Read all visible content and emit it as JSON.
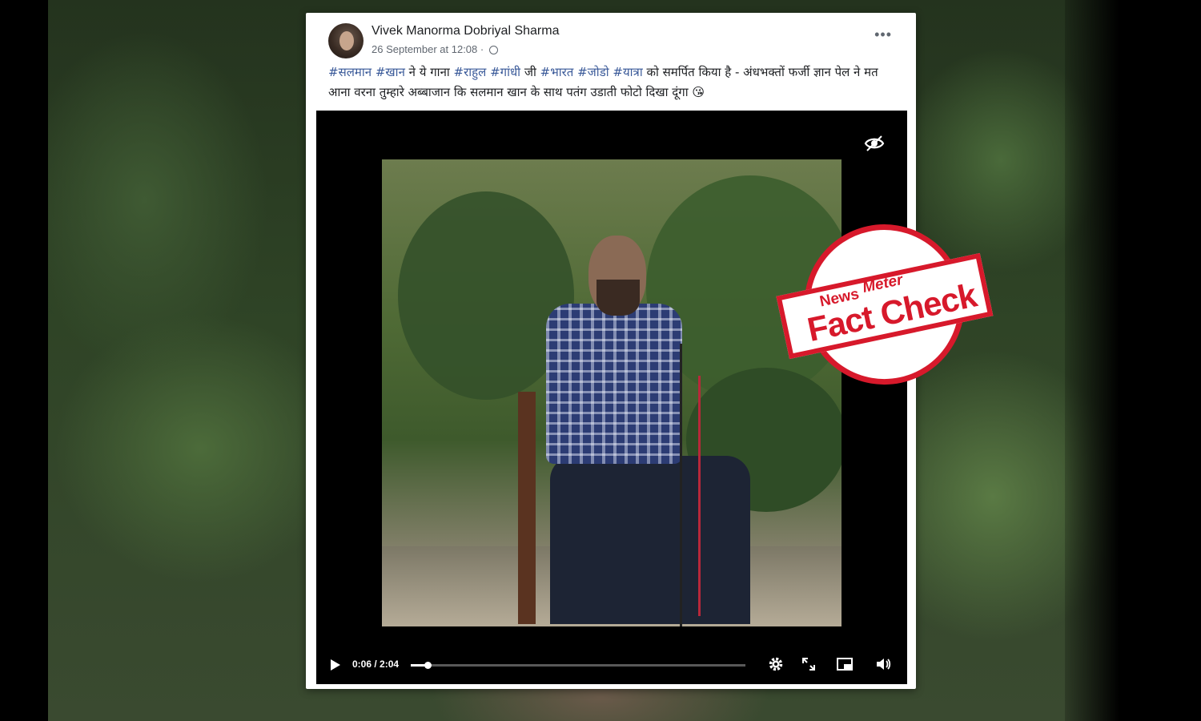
{
  "post": {
    "author": "Vivek Manorma Dobriyal Sharma",
    "timestamp": "26 September at 12:08 ·",
    "more_label": "•••",
    "caption": [
      {
        "text": "#सलमान",
        "tag": true
      },
      {
        "text": " ",
        "tag": false
      },
      {
        "text": "#खान",
        "tag": true
      },
      {
        "text": " ने ये गाना ",
        "tag": false
      },
      {
        "text": "#राहुल",
        "tag": true
      },
      {
        "text": " ",
        "tag": false
      },
      {
        "text": "#गांधी",
        "tag": true
      },
      {
        "text": " जी ",
        "tag": false
      },
      {
        "text": "#भारत",
        "tag": true
      },
      {
        "text": " ",
        "tag": false
      },
      {
        "text": "#जोडो",
        "tag": true
      },
      {
        "text": " ",
        "tag": false
      },
      {
        "text": "#यात्रा",
        "tag": true
      },
      {
        "text": " को समर्पित किया है - अंधभक्तों फर्जी ज्ञान पेल ने मत आना वरना तुम्हारे अब्बाजान कि सलमान खान के साथ पतंग उडाती फोटो दिखा दूंगा 😘",
        "tag": false
      }
    ]
  },
  "video": {
    "time": "0:06 / 2:04",
    "progress": 0.05,
    "icons": [
      "eye-icon",
      "play-icon",
      "settings-icon",
      "fullscreen-icon",
      "miniplayer-icon",
      "volume-icon"
    ]
  },
  "stamp": {
    "news": "News",
    "meter": "Meter",
    "fact_check": "Fact Check",
    "color": "#d7192b"
  }
}
